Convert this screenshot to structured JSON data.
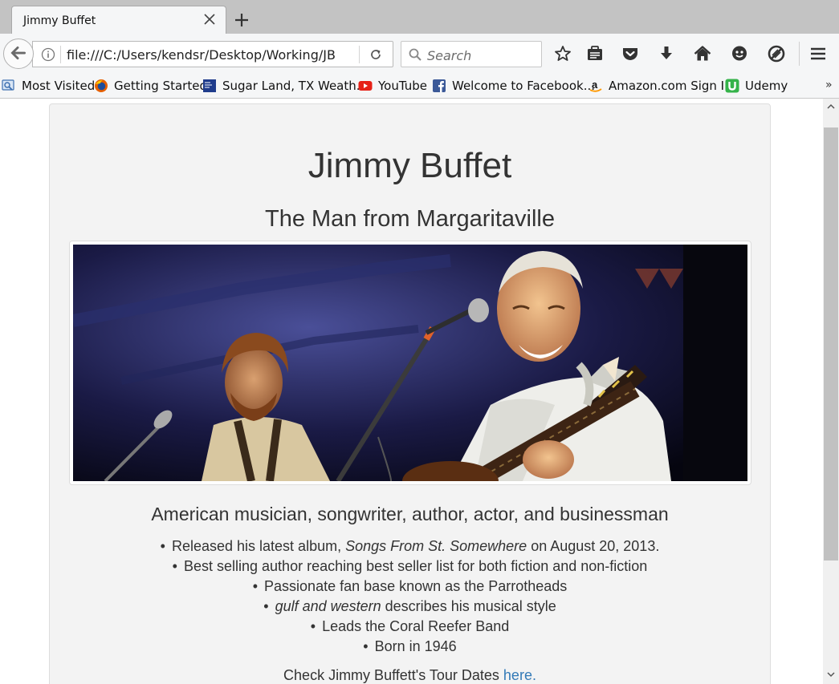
{
  "browser": {
    "tab_title": "Jimmy Buffet",
    "url": "file:///C:/Users/kendsr/Desktop/Working/JB",
    "search_placeholder": "Search",
    "bookmarks": [
      {
        "label": "Most Visited",
        "icon": "most-visited-icon"
      },
      {
        "label": "Getting Started",
        "icon": "firefox-icon"
      },
      {
        "label": "Sugar Land, TX Weath...",
        "icon": "weather-channel-icon"
      },
      {
        "label": "YouTube",
        "icon": "youtube-icon"
      },
      {
        "label": "Welcome to Facebook...",
        "icon": "facebook-icon"
      },
      {
        "label": "Amazon.com Sign In",
        "icon": "amazon-icon"
      },
      {
        "label": "Udemy",
        "icon": "udemy-icon"
      }
    ],
    "overflow_chevron": "»"
  },
  "page": {
    "title": "Jimmy Buffet",
    "subtitle": "The Man from Margaritaville",
    "tagline": "American musician, songwriter, author, actor, and businessman",
    "facts": {
      "album_prefix": "Released his latest album, ",
      "album_title": "Songs From St. Somewhere",
      "album_suffix": " on August 20, 2013.",
      "author": "Best selling author reaching best seller list for both fiction and non-fiction",
      "fans": "Passionate fan base known as the Parrotheads",
      "style_em": "gulf and western",
      "style_suffix": " describes his musical style",
      "band": "Leads the Coral Reefer Band",
      "born": "Born in 1946"
    },
    "tour_prefix": "Check Jimmy Buffett's Tour Dates ",
    "tour_link": "here."
  }
}
